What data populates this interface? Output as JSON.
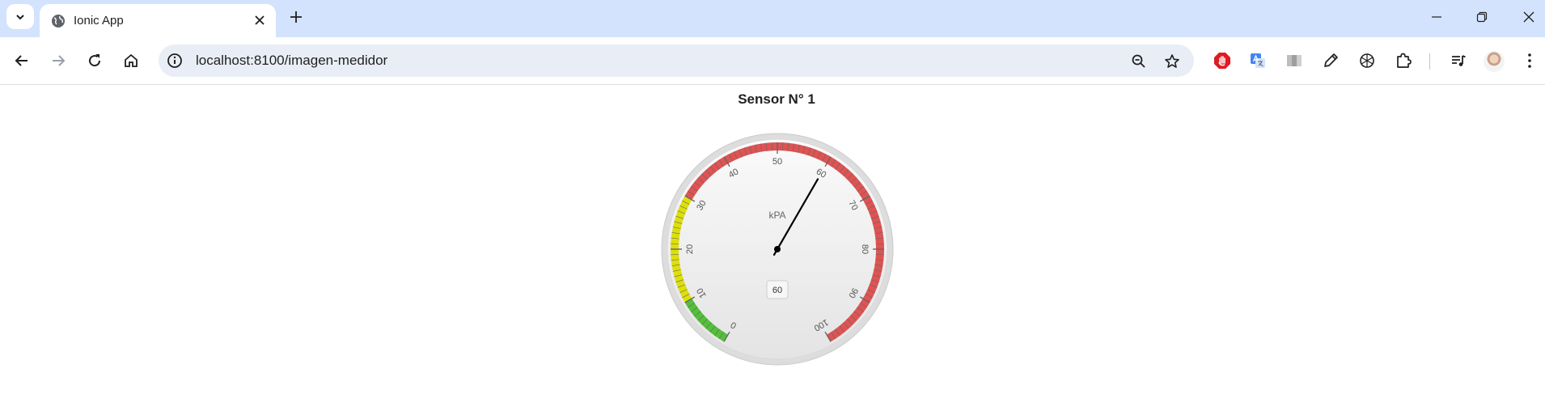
{
  "browser": {
    "tab_title": "Ionic App",
    "url": "localhost:8100/imagen-medidor"
  },
  "page": {
    "title": "Sensor N° 1"
  },
  "gauge": {
    "min": 0,
    "max": 100,
    "value": 60,
    "value_label": "60",
    "unit": "kPA",
    "tick_labels": [
      "0",
      "10",
      "20",
      "30",
      "40",
      "50",
      "60",
      "70",
      "80",
      "90",
      "100"
    ],
    "bands": [
      {
        "from": 0,
        "to": 10,
        "color": "#55bf3b"
      },
      {
        "from": 10,
        "to": 30,
        "color": "#dddf0d"
      },
      {
        "from": 30,
        "to": 100,
        "color": "#df5353"
      }
    ]
  },
  "colors": {
    "chrome_frame": "#d3e3fd",
    "omnibox": "#e9eef6"
  }
}
